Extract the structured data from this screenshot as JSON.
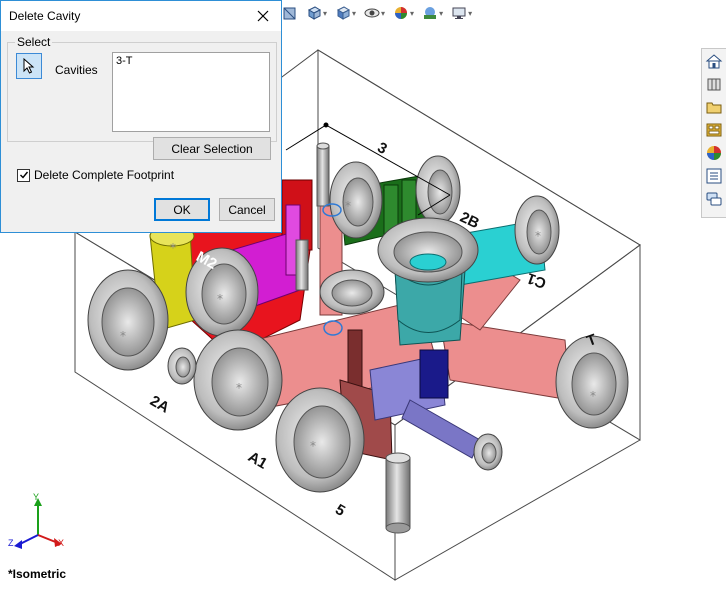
{
  "dialog": {
    "title": "Delete Cavity",
    "select_group": "Select",
    "cavities_label": "Cavities",
    "cavities": [
      "3-T"
    ],
    "clear_selection": "Clear Selection",
    "delete_footprint_label": "Delete Complete Footprint",
    "delete_footprint_checked": true,
    "ok": "OK",
    "cancel": "Cancel"
  },
  "toolbar": {
    "icons": [
      "section-view-icon",
      "view-orientation-icon",
      "display-style-icon",
      "hide-show-icon",
      "appearance-icon",
      "scene-icon",
      "view-settings-icon"
    ]
  },
  "taskpane": {
    "icons": [
      "home-icon",
      "design-library-icon",
      "file-explorer-icon",
      "view-palette-icon",
      "appearances-icon",
      "custom-properties-icon",
      "forum-icon"
    ]
  },
  "viewport": {
    "view_name": "*Isometric",
    "labels": {
      "l3": "3",
      "l2b": "2B",
      "lc1": "C1",
      "lm2": "M2",
      "lt": "T",
      "l2a": "2A",
      "la1": "A1",
      "l5": "5"
    },
    "triad": {
      "x": "X",
      "y": "Y",
      "z": "Z"
    }
  },
  "colors": {
    "accent": "#0078d7",
    "red": "#e8141e",
    "yellow": "#d6d21a",
    "magenta": "#d21ed2",
    "salmon": "#ec8e8e",
    "cyan": "#2ad0d2",
    "green": "#1a6e1a",
    "teal": "#3ca8a8",
    "lavender": "#8a86d6",
    "navy": "#1a1a8a",
    "gray": "#9c9c9c"
  }
}
